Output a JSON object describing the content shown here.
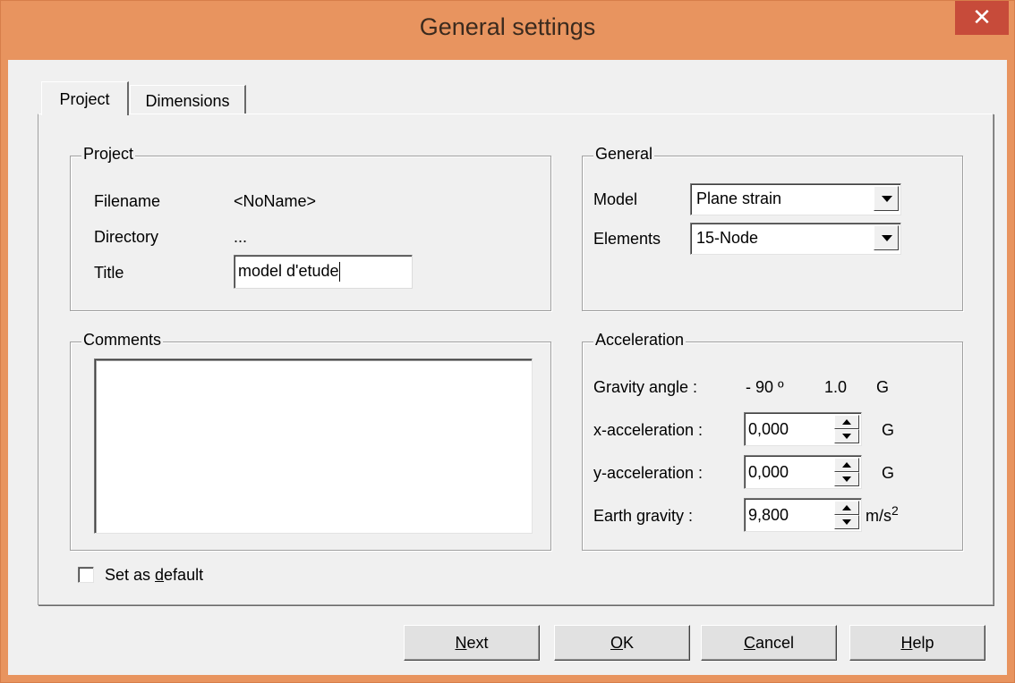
{
  "window": {
    "title": "General settings",
    "close_glyph": "✕"
  },
  "tabs": [
    {
      "label": "Project"
    },
    {
      "label": "Dimensions"
    }
  ],
  "project": {
    "legend": "Project",
    "filename_label": "Filename",
    "filename_value": "<NoName>",
    "directory_label": "Directory",
    "directory_value": "...",
    "title_label": "Title",
    "title_value": "model d'etude"
  },
  "general": {
    "legend": "General",
    "model_label": "Model",
    "model_value": "Plane strain",
    "elements_label": "Elements",
    "elements_value": "15-Node"
  },
  "comments": {
    "legend": "Comments",
    "value": ""
  },
  "acceleration": {
    "legend": "Acceleration",
    "gravity_angle_label": "Gravity angle :",
    "gravity_angle_value": "- 90 º",
    "gravity_g_value": "1.0",
    "gravity_unit": "G",
    "x_label": "x-acceleration :",
    "x_value": "0,000",
    "x_unit": "G",
    "y_label": "y-acceleration :",
    "y_value": "0,000",
    "y_unit": "G",
    "earth_label": "Earth gravity :",
    "earth_value": "9,800",
    "earth_unit": "m/s",
    "earth_unit_sup": "2"
  },
  "default_checkbox": {
    "label_pre": "Set as ",
    "label_ul": "d",
    "label_post": "efault",
    "checked": false
  },
  "buttons": {
    "next": {
      "ul": "N",
      "rest": "ext"
    },
    "ok": {
      "ul": "O",
      "rest": "K"
    },
    "cancel": {
      "ul": "C",
      "rest": "ancel"
    },
    "help": {
      "ul": "H",
      "rest": "elp"
    }
  }
}
